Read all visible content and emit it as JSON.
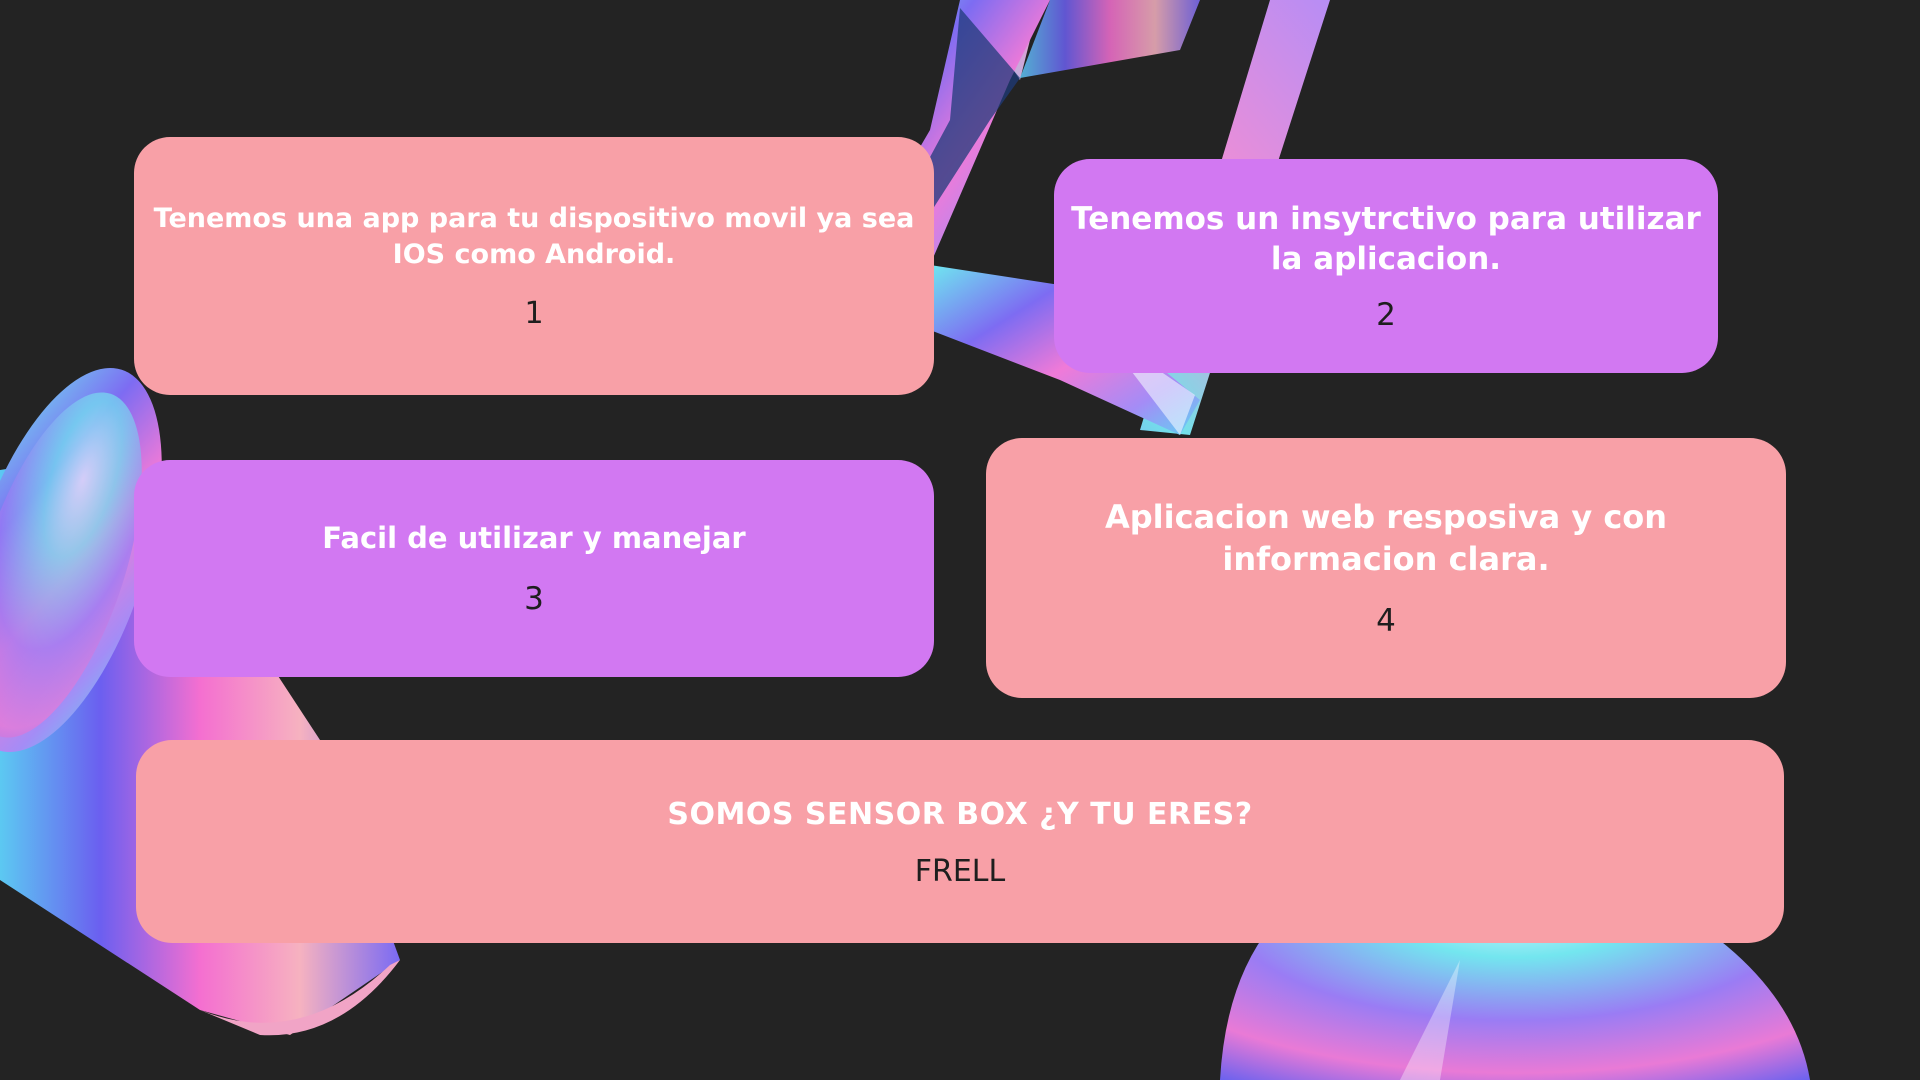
{
  "colors": {
    "background": "#232323",
    "card_pink": "#f8a0a7",
    "card_purple": "#d278f2",
    "title_text": "#ffffff",
    "number_text": "#1e1e1e"
  },
  "cards": [
    {
      "title": "Tenemos una app para tu dispositivo movil ya sea IOS como Android.",
      "number": "1",
      "color": "pink"
    },
    {
      "title": "Tenemos un insytrctivo para utilizar la aplicacion.",
      "number": "2",
      "color": "purple"
    },
    {
      "title": "Facil de utilizar y manejar",
      "number": "3",
      "color": "purple"
    },
    {
      "title": "Aplicacion web resposiva y con informacion clara.",
      "number": "4",
      "color": "pink"
    }
  ],
  "banner": {
    "title": "SOMOS SENSOR BOX ¿Y TU ERES?",
    "subtitle": "FRELL",
    "color": "pink"
  },
  "decorations": [
    {
      "icon": "holographic-frame-shape"
    },
    {
      "icon": "holographic-cylinder-shape"
    },
    {
      "icon": "holographic-dome-shape"
    }
  ]
}
